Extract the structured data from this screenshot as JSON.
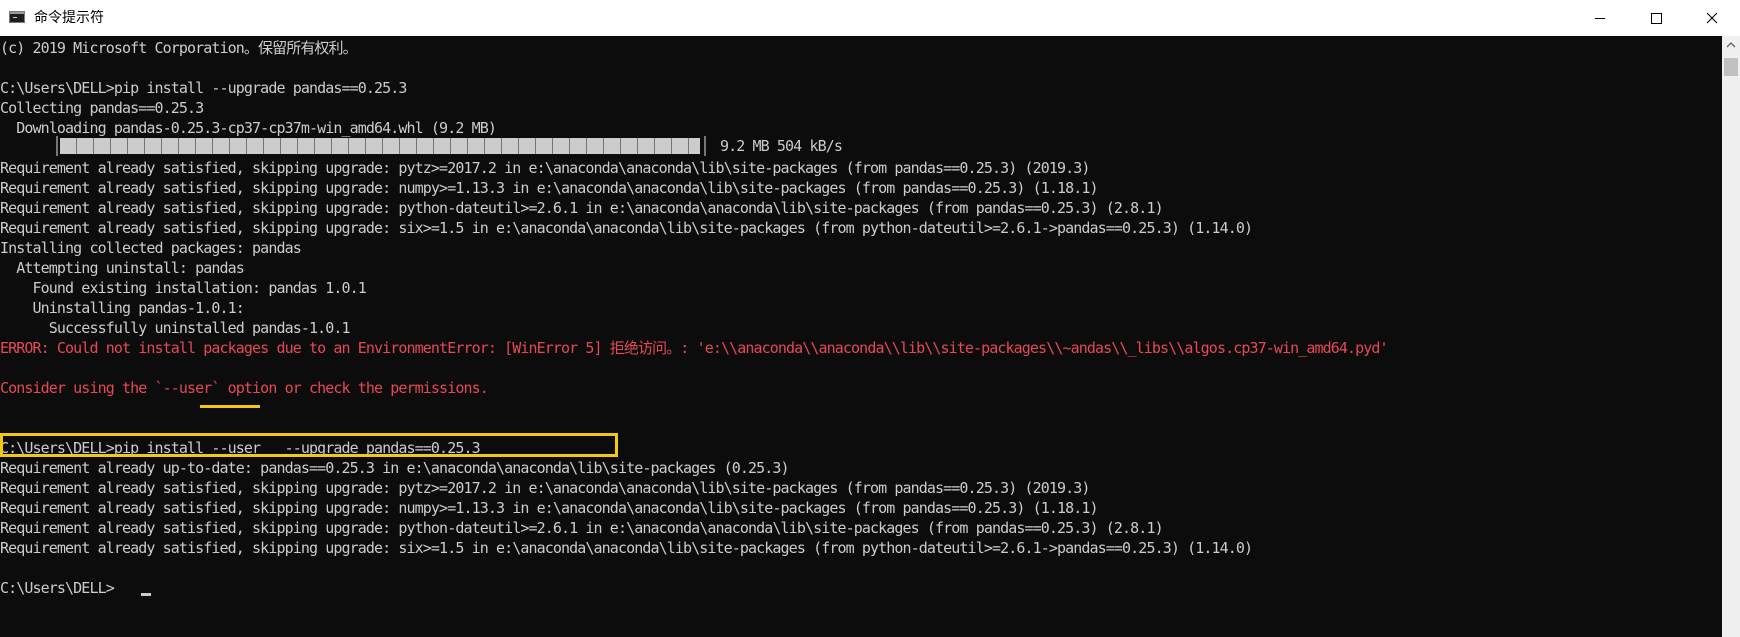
{
  "window": {
    "title": "命令提示符",
    "icon": "cmd-icon",
    "controls": {
      "minimize": "minimize-icon",
      "maximize": "maximize-icon",
      "close": "close-icon"
    }
  },
  "console": {
    "lines": [
      "(c) 2019 Microsoft Corporation。保留所有权利。",
      "",
      "C:\\Users\\DELL>pip install --upgrade pandas==0.25.3",
      "Collecting pandas==0.25.3",
      "  Downloading pandas-0.25.3-cp37-cp37m-win_amd64.whl (9.2 MB)",
      "",
      "Requirement already satisfied, skipping upgrade: pytz>=2017.2 in e:\\anaconda\\anaconda\\lib\\site-packages (from pandas==0.25.3) (2019.3)",
      "Requirement already satisfied, skipping upgrade: numpy>=1.13.3 in e:\\anaconda\\anaconda\\lib\\site-packages (from pandas==0.25.3) (1.18.1)",
      "Requirement already satisfied, skipping upgrade: python-dateutil>=2.6.1 in e:\\anaconda\\anaconda\\lib\\site-packages (from pandas==0.25.3) (2.8.1)",
      "Requirement already satisfied, skipping upgrade: six>=1.5 in e:\\anaconda\\anaconda\\lib\\site-packages (from python-dateutil>=2.6.1->pandas==0.25.3) (1.14.0)",
      "Installing collected packages: pandas",
      "  Attempting uninstall: pandas",
      "    Found existing installation: pandas 1.0.1",
      "    Uninstalling pandas-1.0.1:",
      "      Successfully uninstalled pandas-1.0.1",
      "ERROR: Could not install packages due to an EnvironmentError: [WinError 5] 拒绝访问。: 'e:\\\\anaconda\\\\anaconda\\\\lib\\\\site-packages\\\\~andas\\\\_libs\\\\algos.cp37-win_amd64.pyd'",
      "",
      "Consider using the `--user` option or check the permissions.",
      "",
      "",
      "C:\\Users\\DELL>pip install --user   --upgrade pandas==0.25.3",
      "Requirement already up-to-date: pandas==0.25.3 in e:\\anaconda\\anaconda\\lib\\site-packages (0.25.3)",
      "Requirement already satisfied, skipping upgrade: pytz>=2017.2 in e:\\anaconda\\anaconda\\lib\\site-packages (from pandas==0.25.3) (2019.3)",
      "Requirement already satisfied, skipping upgrade: numpy>=1.13.3 in e:\\anaconda\\anaconda\\lib\\site-packages (from pandas==0.25.3) (1.18.1)",
      "Requirement already satisfied, skipping upgrade: python-dateutil>=2.6.1 in e:\\anaconda\\anaconda\\lib\\site-packages (from pandas==0.25.3) (2.8.1)",
      "Requirement already satisfied, skipping upgrade: six>=1.5 in e:\\anaconda\\anaconda\\lib\\site-packages (from python-dateutil>=2.6.1->pandas==0.25.3) (1.14.0)",
      "",
      "C:\\Users\\DELL>"
    ],
    "progress": {
      "fraction": 1.0,
      "stats": "9.2 MB 504 kB/s"
    }
  },
  "colors": {
    "background": "#0c0c0c",
    "text": "#cccccc",
    "error": "#e74856",
    "annotation": "#f2c811"
  }
}
